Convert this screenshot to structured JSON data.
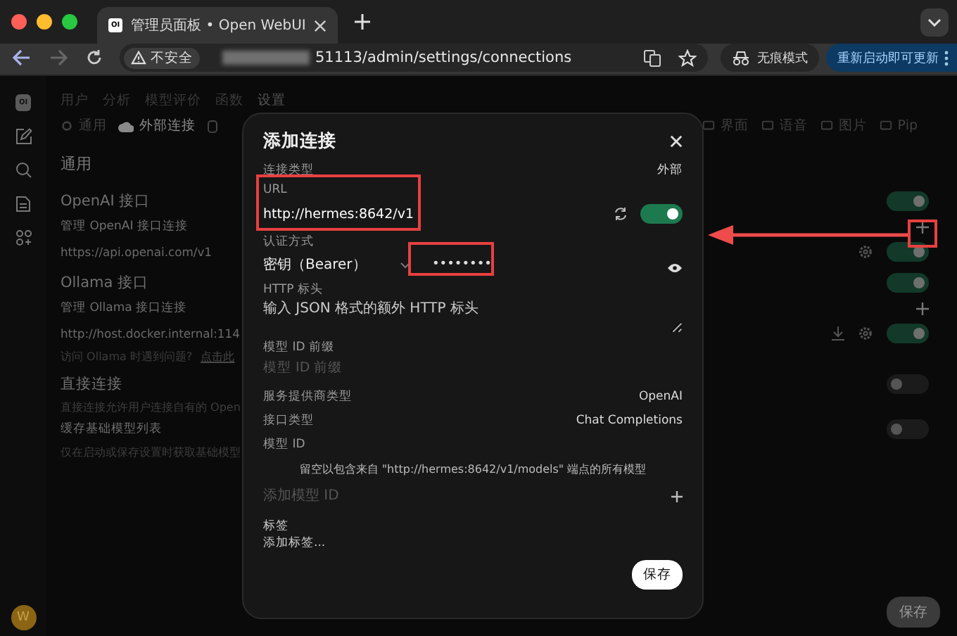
{
  "browser": {
    "tab_title": "管理员面板 • Open WebUI",
    "tab_logo": "OI",
    "address": "51113/admin/settings/connections",
    "security_chip": "不安全",
    "incognito": "无痕模式",
    "update_button": "重新启动即可更新"
  },
  "sidebar": {
    "logo": "OI",
    "avatar": "W"
  },
  "nav_tabs": [
    {
      "label": "用户",
      "selected": false
    },
    {
      "label": "分析",
      "selected": false
    },
    {
      "label": "模型评价",
      "selected": false
    },
    {
      "label": "函数",
      "selected": false
    },
    {
      "label": "设置",
      "selected": true
    }
  ],
  "settings_tabs_left": [
    {
      "label": "通用",
      "selected": false
    },
    {
      "label": "外部连接",
      "selected": true
    }
  ],
  "settings_tabs_right": [
    {
      "label": "界面",
      "selected": false
    },
    {
      "label": "语音",
      "selected": false
    },
    {
      "label": "图片",
      "selected": false
    },
    {
      "label": "Pip",
      "selected": false
    }
  ],
  "section_title": "通用",
  "rows": [
    {
      "kind": "heading",
      "text": "OpenAI 接口",
      "toggle": {
        "on": true
      }
    },
    {
      "kind": "sub",
      "text": "管理 OpenAI 接口连接",
      "add": true
    },
    {
      "kind": "value",
      "text": "https://api.openai.com/v1",
      "gear": true,
      "toggle": {
        "on": true
      }
    },
    {
      "kind": "heading",
      "text": "Ollama 接口",
      "toggle": {
        "on": true
      }
    },
    {
      "kind": "sub",
      "text": "管理 Ollama 接口连接",
      "add": true
    },
    {
      "kind": "value",
      "text": "http://host.docker.internal:114",
      "download": true,
      "gear": true,
      "toggle": {
        "on": true
      }
    },
    {
      "kind": "note",
      "text": "访问 Ollama 时遇到问题?",
      "link": "点击此"
    },
    {
      "kind": "heading",
      "text": "直接连接",
      "toggle": {
        "on": false
      }
    },
    {
      "kind": "note",
      "text": "直接连接允许用户连接自有的 Open"
    },
    {
      "kind": "sub",
      "text": "缓存基础模型列表",
      "toggle": {
        "on": false
      }
    },
    {
      "kind": "note",
      "text": "仅在启动或保存设置时获取基础模型"
    }
  ],
  "page_save": "保存",
  "modal": {
    "title": "添加连接",
    "connection_type": {
      "label": "连接类型",
      "value": "外部"
    },
    "url": {
      "label": "URL",
      "value": "http://hermes:8642/v1",
      "enabled": true
    },
    "auth": {
      "label": "认证方式",
      "method": "密钥（Bearer）",
      "key": "••••••••"
    },
    "headers": {
      "label": "HTTP 标头",
      "placeholder": "输入 JSON 格式的额外 HTTP 标头"
    },
    "prefix": {
      "label": "模型 ID 前缀",
      "placeholder": "模型 ID 前缀"
    },
    "provider": {
      "label": "服务提供商类型",
      "value": "OpenAI"
    },
    "api_type": {
      "label": "接口类型",
      "value": "Chat Completions"
    },
    "model_ids": {
      "label": "模型 ID",
      "hint": "留空以包含来自 \"http://hermes:8642/v1/models\" 端点的所有模型",
      "placeholder": "添加模型 ID"
    },
    "tags": {
      "label": "标签",
      "placeholder": "添加标签..."
    },
    "save": "保存"
  }
}
